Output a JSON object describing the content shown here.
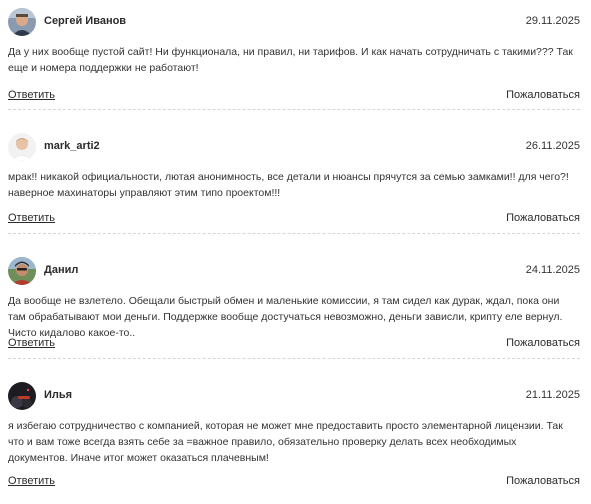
{
  "comments": [
    {
      "author": "Сергей Иванов",
      "date": "29.11.2025",
      "text": "Да у них вообще пустой сайт! Ни функционала, ни правил, ни тарифов. И как начать сотрудничать с такими??? Так еще и номера поддержки не работают!",
      "reply_label": "Ответить",
      "report_label": "Пожаловаться",
      "avatar": "avatar-sergey"
    },
    {
      "author": "mark_arti2",
      "date": "26.11.2025",
      "text": "мрак!! никакой официальности, лютая анонимность, все детали и нюансы прячутся за семью замками!! для чего?! наверное махинаторы управляют этим типо проектом!!!",
      "reply_label": "Ответить",
      "report_label": "Пожаловаться",
      "avatar": "avatar-mark"
    },
    {
      "author": "Данил",
      "date": "24.11.2025",
      "text": "Да вообще не взлетело. Обещали быстрый обмен и маленькие комиссии, я там сидел как дурак, ждал, пока они там обрабатывают мои деньги. Поддержке вообще достучаться невозможно, деньги зависли, крипту еле вернул. Чисто кидалово какое-то..",
      "reply_label": "Ответить",
      "report_label": "Пожаловаться",
      "avatar": "avatar-danil"
    },
    {
      "author": "Илья",
      "date": "21.11.2025",
      "text": "я избегаю сотрудничество с компанией, которая не может мне предоставить просто элементарной лицензии. Так что и вам тоже всегда взять себе за =важное правило, обязательно проверку делать всех необходимых документов. Иначе итог может оказаться плачевным!",
      "reply_label": "Ответить",
      "report_label": "Пожаловаться",
      "avatar": "avatar-ilya"
    }
  ]
}
